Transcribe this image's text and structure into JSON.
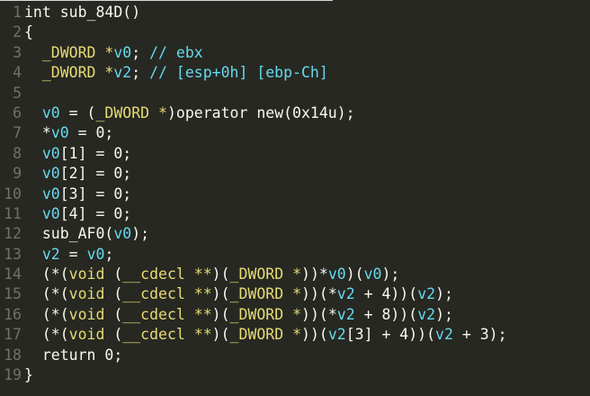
{
  "editor": {
    "language": "c",
    "theme_colors": {
      "background": "#272822",
      "foreground": "#f8f8f2",
      "line_numbers": "#70716a",
      "cyan": "#66d9ef",
      "yellow": "#e6db74"
    },
    "lines": [
      {
        "num": "1",
        "tokens": [
          [
            "plain",
            "int sub_84D()"
          ]
        ]
      },
      {
        "num": "2",
        "tokens": [
          [
            "plain",
            "{"
          ]
        ]
      },
      {
        "num": "3",
        "tokens": [
          [
            "plain",
            "  "
          ],
          [
            "y",
            "_DWORD"
          ],
          [
            "plain",
            " "
          ],
          [
            "y",
            "*"
          ],
          [
            "var",
            "v0"
          ],
          [
            "plain",
            "; "
          ],
          [
            "cmt",
            "// ebx"
          ]
        ]
      },
      {
        "num": "4",
        "tokens": [
          [
            "plain",
            "  "
          ],
          [
            "y",
            "_DWORD"
          ],
          [
            "plain",
            " "
          ],
          [
            "y",
            "*"
          ],
          [
            "var",
            "v2"
          ],
          [
            "plain",
            "; "
          ],
          [
            "cmt",
            "// [esp+0h] [ebp-Ch]"
          ]
        ]
      },
      {
        "num": "5",
        "tokens": [
          [
            "plain",
            ""
          ]
        ]
      },
      {
        "num": "6",
        "tokens": [
          [
            "plain",
            "  "
          ],
          [
            "var",
            "v0"
          ],
          [
            "plain",
            " = ("
          ],
          [
            "y",
            "_DWORD"
          ],
          [
            "plain",
            " "
          ],
          [
            "y",
            "*"
          ],
          [
            "plain",
            ")operator new(0x14u);"
          ]
        ]
      },
      {
        "num": "7",
        "tokens": [
          [
            "plain",
            "  *"
          ],
          [
            "var",
            "v0"
          ],
          [
            "plain",
            " = 0;"
          ]
        ]
      },
      {
        "num": "8",
        "tokens": [
          [
            "plain",
            "  "
          ],
          [
            "var",
            "v0"
          ],
          [
            "plain",
            "[1] = 0;"
          ]
        ]
      },
      {
        "num": "9",
        "tokens": [
          [
            "plain",
            "  "
          ],
          [
            "var",
            "v0"
          ],
          [
            "plain",
            "[2] = 0;"
          ]
        ]
      },
      {
        "num": "10",
        "tokens": [
          [
            "plain",
            "  "
          ],
          [
            "var",
            "v0"
          ],
          [
            "plain",
            "[3] = 0;"
          ]
        ]
      },
      {
        "num": "11",
        "tokens": [
          [
            "plain",
            "  "
          ],
          [
            "var",
            "v0"
          ],
          [
            "plain",
            "[4] = 0;"
          ]
        ]
      },
      {
        "num": "12",
        "tokens": [
          [
            "plain",
            "  sub_AF0("
          ],
          [
            "var",
            "v0"
          ],
          [
            "plain",
            ");"
          ]
        ]
      },
      {
        "num": "13",
        "tokens": [
          [
            "plain",
            "  "
          ],
          [
            "var",
            "v2"
          ],
          [
            "plain",
            " = "
          ],
          [
            "var",
            "v0"
          ],
          [
            "plain",
            ";"
          ]
        ]
      },
      {
        "num": "14",
        "tokens": [
          [
            "plain",
            "  (*("
          ],
          [
            "y",
            "void"
          ],
          [
            "plain",
            " ("
          ],
          [
            "y",
            "__cdecl"
          ],
          [
            "plain",
            " "
          ],
          [
            "y",
            "**"
          ],
          [
            "plain",
            ")("
          ],
          [
            "y",
            "_DWORD"
          ],
          [
            "plain",
            " "
          ],
          [
            "y",
            "*"
          ],
          [
            "plain",
            "))*"
          ],
          [
            "var",
            "v0"
          ],
          [
            "plain",
            ")("
          ],
          [
            "var",
            "v0"
          ],
          [
            "plain",
            ");"
          ]
        ]
      },
      {
        "num": "15",
        "tokens": [
          [
            "plain",
            "  (*("
          ],
          [
            "y",
            "void"
          ],
          [
            "plain",
            " ("
          ],
          [
            "y",
            "__cdecl"
          ],
          [
            "plain",
            " "
          ],
          [
            "y",
            "**"
          ],
          [
            "plain",
            ")("
          ],
          [
            "y",
            "_DWORD"
          ],
          [
            "plain",
            " "
          ],
          [
            "y",
            "*"
          ],
          [
            "plain",
            "))(*"
          ],
          [
            "var",
            "v2"
          ],
          [
            "plain",
            " + 4))("
          ],
          [
            "var",
            "v2"
          ],
          [
            "plain",
            ");"
          ]
        ]
      },
      {
        "num": "16",
        "tokens": [
          [
            "plain",
            "  (*("
          ],
          [
            "y",
            "void"
          ],
          [
            "plain",
            " ("
          ],
          [
            "y",
            "__cdecl"
          ],
          [
            "plain",
            " "
          ],
          [
            "y",
            "**"
          ],
          [
            "plain",
            ")("
          ],
          [
            "y",
            "_DWORD"
          ],
          [
            "plain",
            " "
          ],
          [
            "y",
            "*"
          ],
          [
            "plain",
            "))(*"
          ],
          [
            "var",
            "v2"
          ],
          [
            "plain",
            " + 8))("
          ],
          [
            "var",
            "v2"
          ],
          [
            "plain",
            ");"
          ]
        ]
      },
      {
        "num": "17",
        "tokens": [
          [
            "plain",
            "  (*("
          ],
          [
            "y",
            "void"
          ],
          [
            "plain",
            " ("
          ],
          [
            "y",
            "__cdecl"
          ],
          [
            "plain",
            " "
          ],
          [
            "y",
            "**"
          ],
          [
            "plain",
            ")("
          ],
          [
            "y",
            "_DWORD"
          ],
          [
            "plain",
            " "
          ],
          [
            "y",
            "*"
          ],
          [
            "plain",
            "))("
          ],
          [
            "var",
            "v2"
          ],
          [
            "plain",
            "[3] + 4))("
          ],
          [
            "var",
            "v2"
          ],
          [
            "plain",
            " + 3);"
          ]
        ]
      },
      {
        "num": "18",
        "tokens": [
          [
            "plain",
            "  return 0;"
          ]
        ]
      },
      {
        "num": "19",
        "tokens": [
          [
            "plain",
            "}"
          ]
        ]
      }
    ]
  }
}
